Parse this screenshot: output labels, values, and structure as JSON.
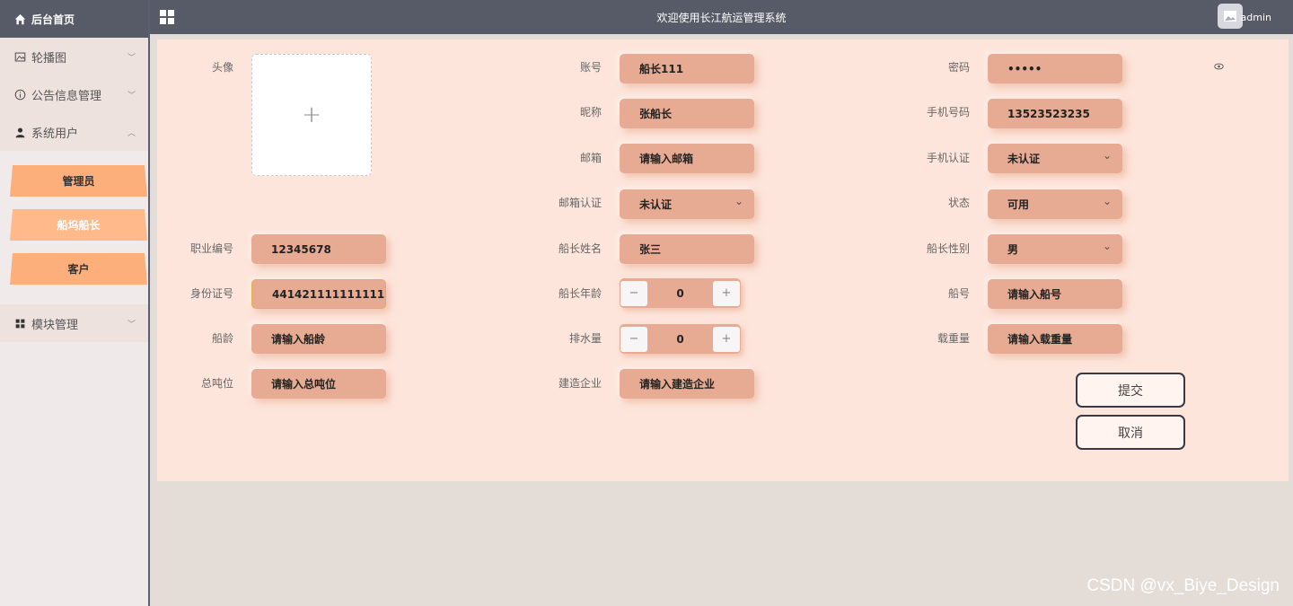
{
  "sidebar": {
    "home_label": "后台首页",
    "menu": [
      {
        "label": "轮播图",
        "icon": "image-icon"
      },
      {
        "label": "公告信息管理",
        "icon": "info-icon"
      },
      {
        "label": "系统用户",
        "icon": "user-icon"
      },
      {
        "label": "模块管理",
        "icon": "module-icon"
      }
    ],
    "submenu": [
      "管理员",
      "船坞船长",
      "客户"
    ]
  },
  "header": {
    "title": "欢迎使用长江航运管理系统",
    "user": "admin"
  },
  "form": {
    "avatar_label": "头像",
    "account": {
      "label": "账号",
      "value": "船长111"
    },
    "password": {
      "label": "密码",
      "value": "•••••"
    },
    "nickname": {
      "label": "昵称",
      "value": "张船长"
    },
    "phone": {
      "label": "手机号码",
      "value": "13523523235"
    },
    "email": {
      "label": "邮箱",
      "placeholder": "请输入邮箱"
    },
    "phone_verify": {
      "label": "手机认证",
      "value": "未认证"
    },
    "email_verify": {
      "label": "邮箱认证",
      "value": "未认证"
    },
    "status": {
      "label": "状态",
      "value": "可用"
    },
    "job_no": {
      "label": "职业编号",
      "value": "12345678"
    },
    "captain_name": {
      "label": "船长姓名",
      "value": "张三"
    },
    "captain_gender": {
      "label": "船长性别",
      "value": "男"
    },
    "id_card": {
      "label": "身份证号",
      "value": "441421111111111"
    },
    "captain_age": {
      "label": "船长年龄",
      "value": "0"
    },
    "ship_no": {
      "label": "船号",
      "placeholder": "请输入船号"
    },
    "ship_age": {
      "label": "船龄",
      "placeholder": "请输入船龄"
    },
    "displacement": {
      "label": "排水量",
      "value": "0"
    },
    "load": {
      "label": "载重量",
      "placeholder": "请输入载重量"
    },
    "tonnage": {
      "label": "总吨位",
      "placeholder": "请输入总吨位"
    },
    "builder": {
      "label": "建造企业",
      "placeholder": "请输入建造企业"
    },
    "submit": "提交",
    "cancel": "取消"
  },
  "watermark": "CSDN @vx_Biye_Design"
}
